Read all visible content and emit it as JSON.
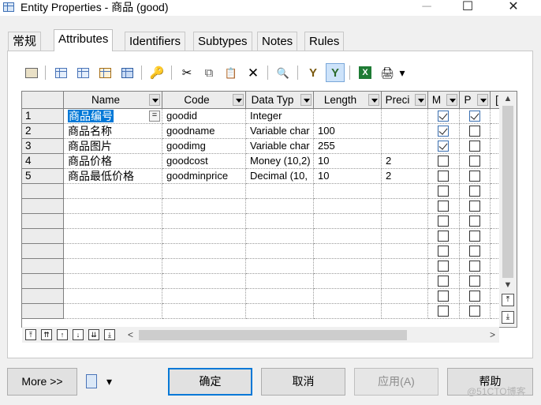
{
  "window": {
    "title": "Entity Properties - 商品 (good)",
    "controls": {
      "minimize": "─",
      "maximize": "☐",
      "close": "✕"
    }
  },
  "tabs": [
    {
      "label": "常规",
      "active": false
    },
    {
      "label": "Attributes",
      "active": true
    },
    {
      "label": "Identifiers",
      "active": false
    },
    {
      "label": "Subtypes",
      "active": false
    },
    {
      "label": "Notes",
      "active": false
    },
    {
      "label": "Rules",
      "active": false
    }
  ],
  "toolbar": {
    "icons": [
      "properties-icon",
      "add-row-icon",
      "insert-row-icon",
      "add-attributes-icon",
      "reuse-attributes-icon",
      "key-icon",
      "cut-icon",
      "copy-icon",
      "paste-icon",
      "delete-icon",
      "find-icon",
      "filter-icon",
      "customize-columns-icon",
      "excel-export-icon",
      "print-icon",
      "dropdown-arrow-icon"
    ],
    "glyphs": {
      "cut": "✂",
      "copy": "⧉",
      "paste": "📋",
      "delete": "✕",
      "find": "🔍",
      "key": "🔑",
      "print": "🖨",
      "dropdown": "▾",
      "excel": "X"
    }
  },
  "grid": {
    "columns": [
      {
        "label": "Name"
      },
      {
        "label": "Code"
      },
      {
        "label": "Data Typ"
      },
      {
        "label": "Length"
      },
      {
        "label": "Preci"
      },
      {
        "label": "M"
      },
      {
        "label": "P"
      },
      {
        "label": "["
      }
    ],
    "rows": [
      {
        "num": "1",
        "name": "商品编号",
        "code": "goodid",
        "type": "Integer",
        "length": "",
        "precision": "",
        "m": true,
        "p": true,
        "selected": true
      },
      {
        "num": "2",
        "name": "商品名称",
        "code": "goodname",
        "type": "Variable char",
        "length": "100",
        "precision": "",
        "m": true,
        "p": false
      },
      {
        "num": "3",
        "name": "商品图片",
        "code": "goodimg",
        "type": "Variable char",
        "length": "255",
        "precision": "",
        "m": true,
        "p": false
      },
      {
        "num": "4",
        "name": "商品价格",
        "code": "goodcost",
        "type": "Money (10,2)",
        "length": "10",
        "precision": "2",
        "m": false,
        "p": false
      },
      {
        "num": "5",
        "name": "商品最低价格",
        "code": "goodminprice",
        "type": "Decimal (10,",
        "length": "10",
        "precision": "2",
        "m": false,
        "p": false
      }
    ],
    "empty_rows": 9,
    "name_button": "=",
    "row_nav_glyphs": [
      "⤒",
      "⇈",
      "↑",
      "↓",
      "⇊",
      "⤓"
    ],
    "scroll": {
      "up": "▲",
      "down": "▼",
      "left": "<",
      "right": ">",
      "top": "⤒",
      "bottom": "⤓"
    }
  },
  "buttons": {
    "more": "More >>",
    "ok": "确定",
    "cancel": "取消",
    "apply": "应用(A)",
    "help": "帮助"
  },
  "watermark": "@51CTO博客"
}
